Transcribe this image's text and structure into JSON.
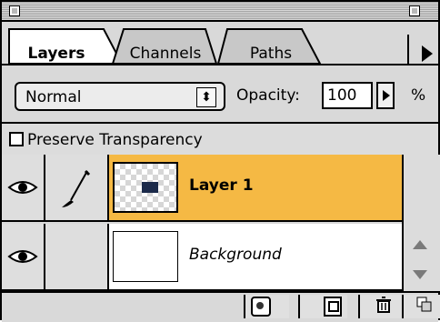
{
  "tabs": [
    {
      "label": "Layers",
      "active": true
    },
    {
      "label": "Channels",
      "active": false
    },
    {
      "label": "Paths",
      "active": false
    }
  ],
  "blend": {
    "mode": "Normal"
  },
  "opacity": {
    "label": "Opacity:",
    "value": "100",
    "unit": "%"
  },
  "preserve": {
    "label": "Preserve Transparency"
  },
  "layers": [
    {
      "name": "Layer 1",
      "selected": true
    },
    {
      "name": "Background",
      "selected": false
    }
  ],
  "colors": {
    "selected_layer": "#F5B944",
    "panel_bg": "#D9D9D9"
  },
  "icons": [
    "close-box-icon",
    "zoom-box-icon",
    "menu-arrow-icon",
    "eye-icon",
    "paintbrush-icon",
    "layer-mask-icon",
    "new-layer-icon",
    "trash-icon"
  ]
}
